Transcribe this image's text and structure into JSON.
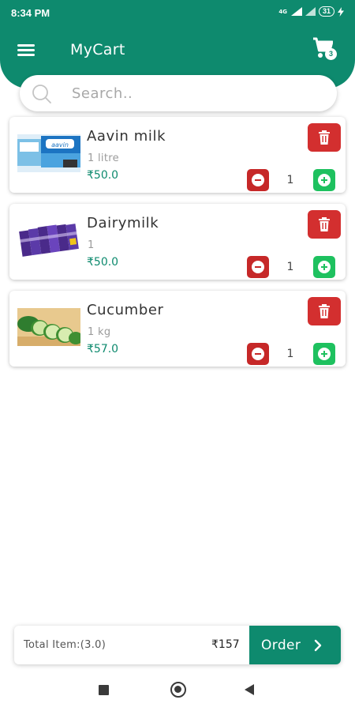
{
  "status_bar": {
    "time": "8:34 PM",
    "network": "4G",
    "battery": "31"
  },
  "header": {
    "title": "MyCart",
    "cart_badge": "3"
  },
  "search": {
    "placeholder": "Search.."
  },
  "cart": {
    "items": [
      {
        "name": "Aavin milk",
        "qty": "1 litre",
        "price": "₹50.0",
        "count": "1"
      },
      {
        "name": "Dairymilk",
        "qty": "1",
        "price": "₹50.0",
        "count": "1"
      },
      {
        "name": "Cucumber",
        "qty": "1 kg",
        "price": "₹57.0",
        "count": "1"
      }
    ]
  },
  "footer": {
    "total_label": "Total Item:(3.0)",
    "total_price": "₹157",
    "order_label": "Order"
  },
  "colors": {
    "primary": "#0e8a6e",
    "delete": "#d32f2f",
    "decrement": "#c62828",
    "increment": "#1ec15f"
  }
}
